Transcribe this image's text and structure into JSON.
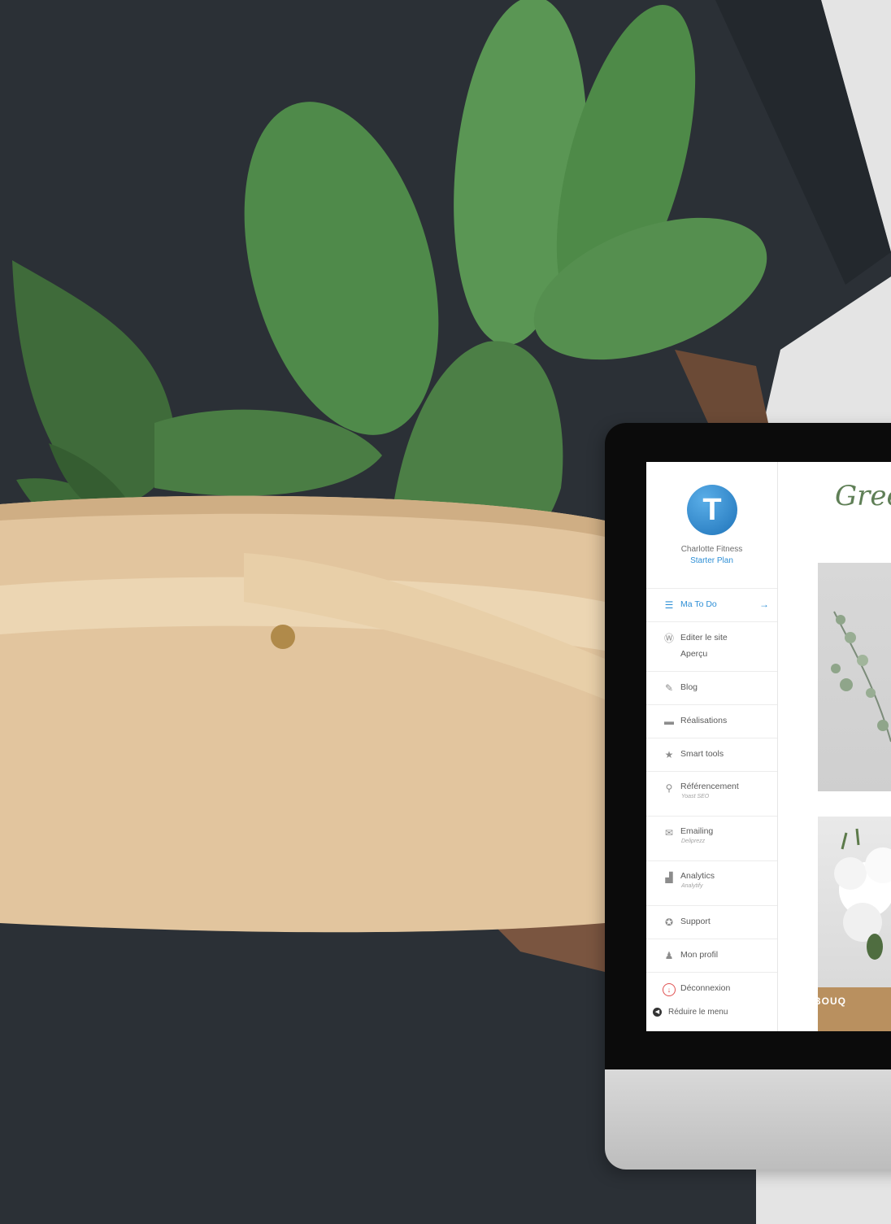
{
  "sidebar": {
    "logo_letter": "T",
    "account_name": "Charlotte Fitness",
    "plan": "Starter Plan",
    "items": [
      {
        "label": "Ma To Do",
        "icon": "list-icon"
      },
      {
        "label": "Editer le site",
        "label2": "Aperçu",
        "icon": "wordpress-icon"
      },
      {
        "label": "Blog",
        "icon": "pin-icon"
      },
      {
        "label": "Réalisations",
        "icon": "folder-icon"
      },
      {
        "label": "Smart tools",
        "icon": "star-icon"
      },
      {
        "label": "Référencement",
        "sub": "Yoast SEO",
        "icon": "search-icon"
      },
      {
        "label": "Emailing",
        "sub": "Deliprezz",
        "icon": "mail-icon"
      },
      {
        "label": "Analytics",
        "sub": "Analytify",
        "icon": "chart-icon"
      },
      {
        "label": "Support",
        "icon": "lifebuoy-icon"
      },
      {
        "label": "Mon profil",
        "icon": "user-icon"
      },
      {
        "label": "Déconnexion",
        "icon": "power-icon"
      }
    ],
    "reduce_label": "Réduire le menu"
  },
  "preview": {
    "title": "Gree",
    "banner": "BOUQ"
  },
  "colors": {
    "accent": "#2e8fd6",
    "script_green": "#5f7f56",
    "logout_red": "#e05050"
  }
}
